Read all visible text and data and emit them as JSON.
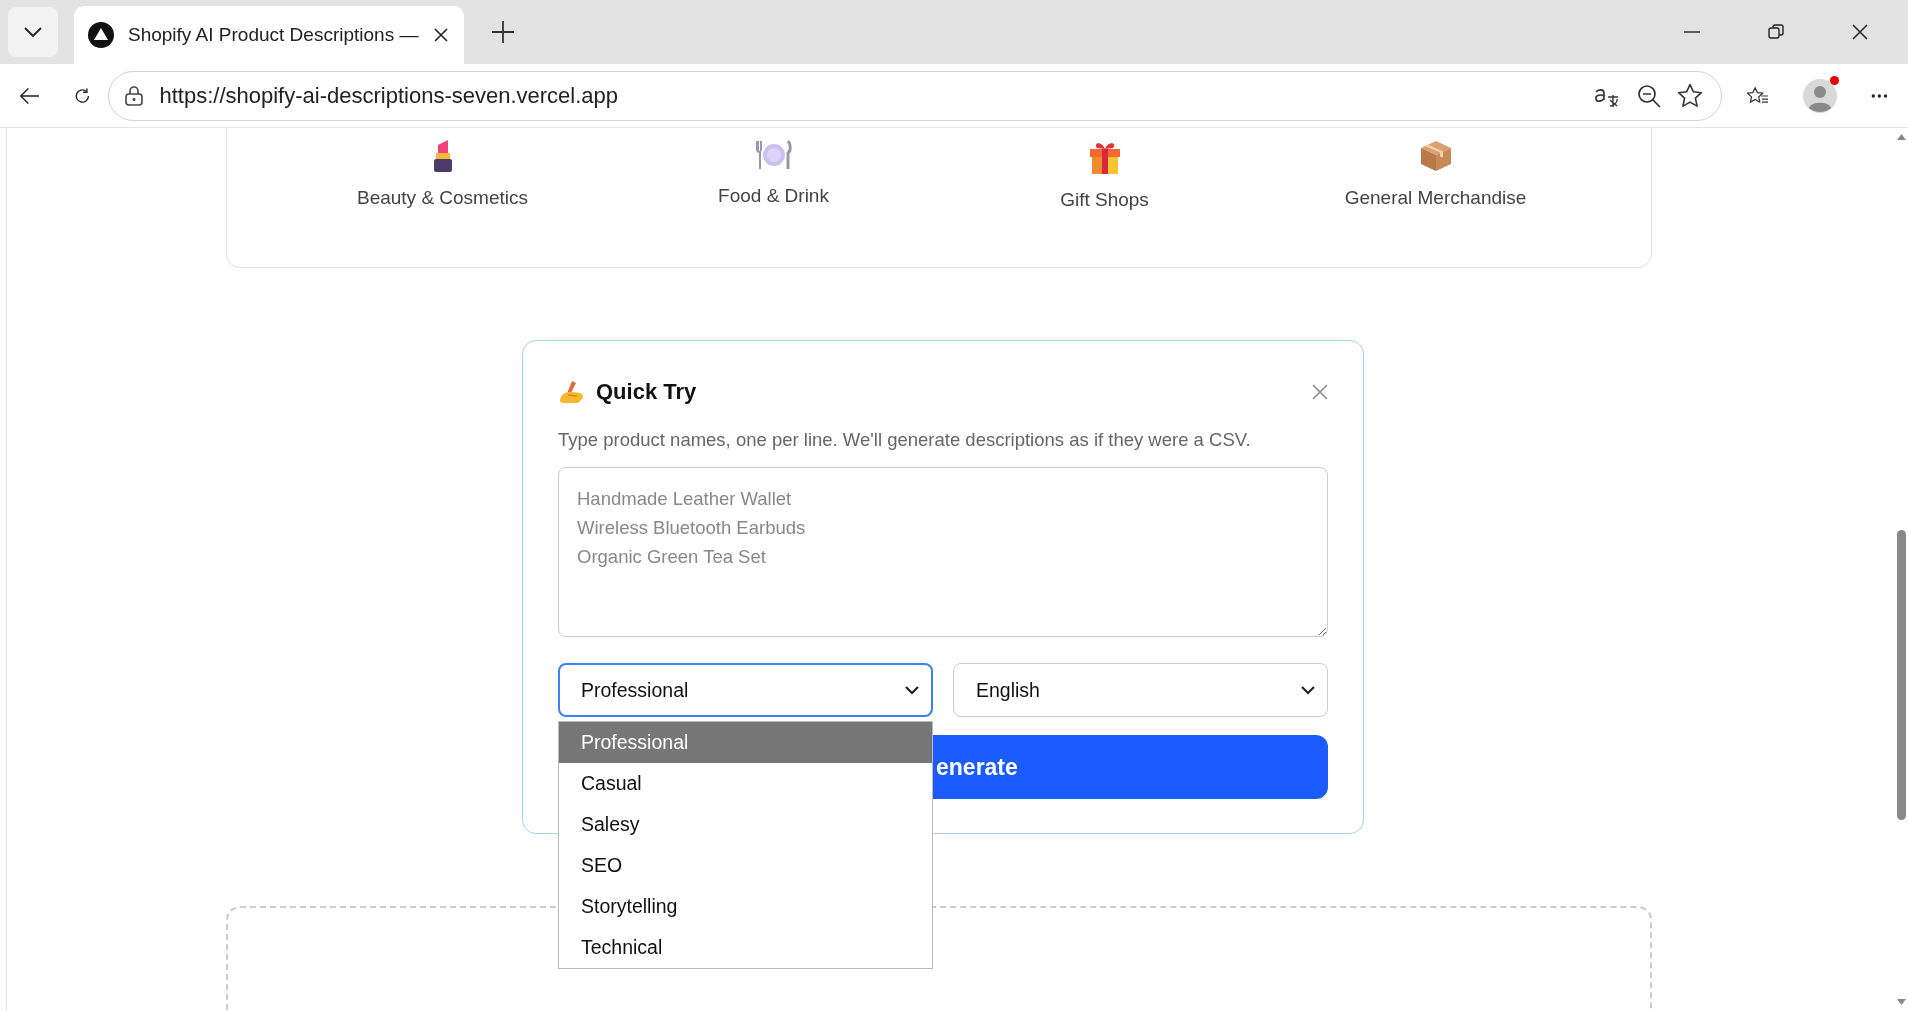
{
  "browser": {
    "tab": {
      "title": "Shopify AI Product Descriptions —"
    },
    "address": "https://shopify-ai-descriptions-seven.vercel.app",
    "profile_notification": true
  },
  "categories": [
    {
      "label": "Beauty & Cosmetics",
      "kind": "lipstick"
    },
    {
      "label": "Food & Drink",
      "kind": "plate"
    },
    {
      "label": "Gift Shops",
      "kind": "gift"
    },
    {
      "label": "General Merchandise",
      "kind": "package"
    }
  ],
  "quick_try": {
    "title": "Quick Try",
    "description": "Type product names, one per line. We'll generate descriptions as if they were a CSV.",
    "textarea": {
      "placeholder": "Handmade Leather Wallet\nWireless Bluetooth Earbuds\nOrganic Green Tea Set"
    },
    "tone_select": {
      "value": "Professional",
      "open": true,
      "options": [
        {
          "label": "Professional",
          "selected": true
        },
        {
          "label": "Casual",
          "selected": false
        },
        {
          "label": "Salesy",
          "selected": false
        },
        {
          "label": "SEO",
          "selected": false
        },
        {
          "label": "Storytelling",
          "selected": false
        },
        {
          "label": "Technical",
          "selected": false
        }
      ]
    },
    "language_select": {
      "value": "English"
    },
    "generate_button": "enerate"
  }
}
